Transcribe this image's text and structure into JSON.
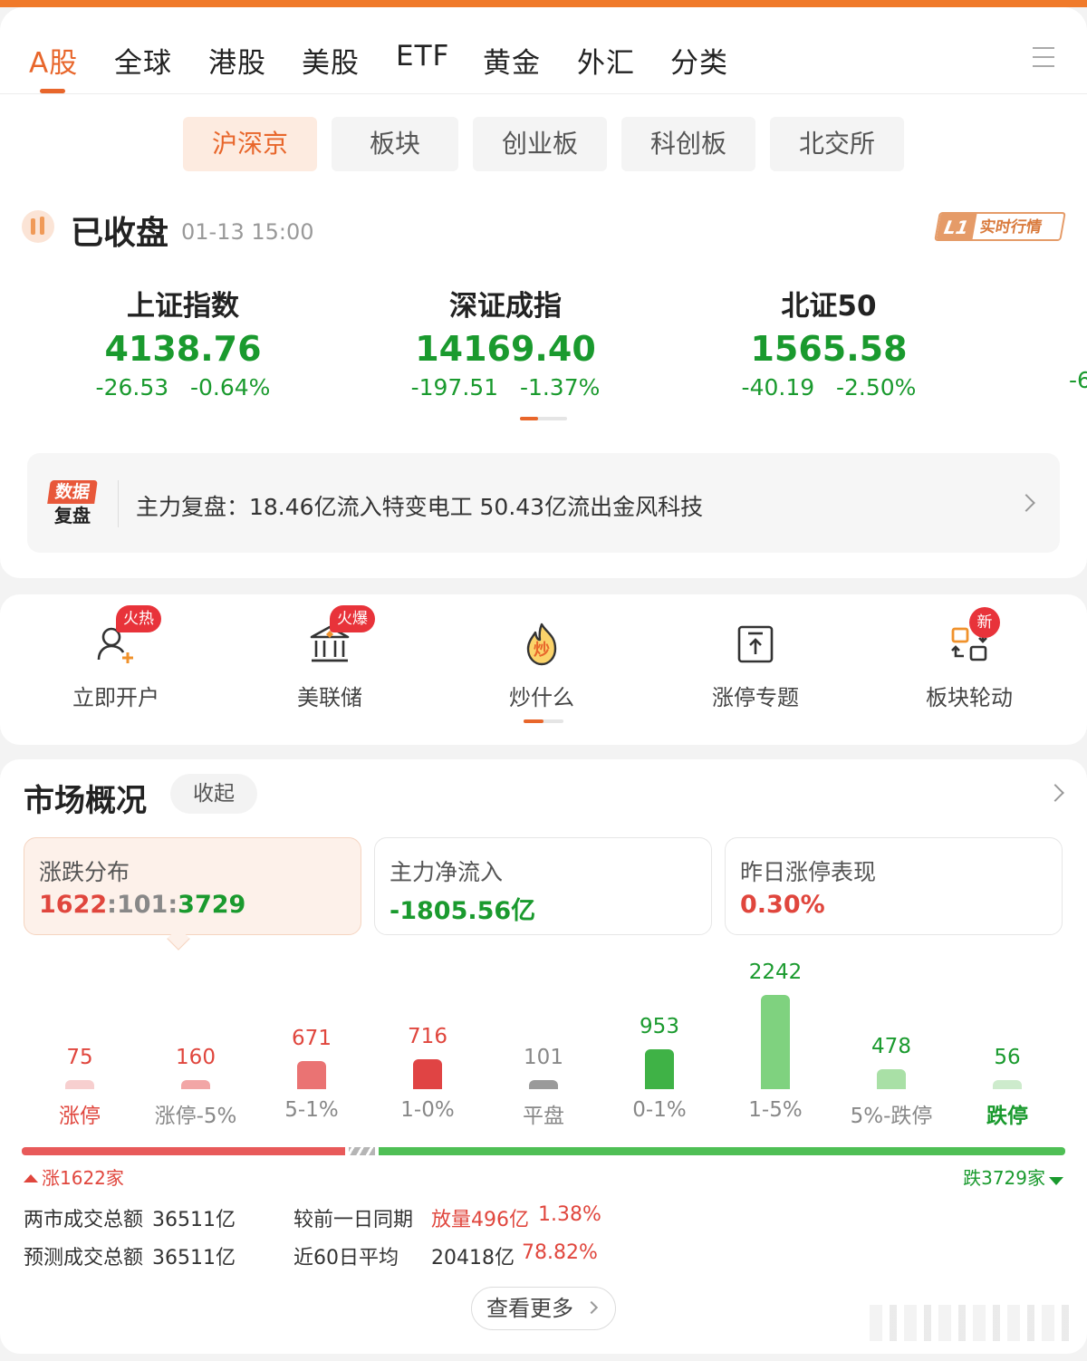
{
  "top_tabs": [
    "A股",
    "全球",
    "港股",
    "美股",
    "ETF",
    "黄金",
    "外汇",
    "分类"
  ],
  "active_top_tab": "A股",
  "sub_tabs": [
    "沪深京",
    "板块",
    "创业板",
    "科创板",
    "北交所"
  ],
  "active_sub_tab": "沪深京",
  "status": {
    "title": "已收盘",
    "time": "01-13 15:00",
    "badge_level": "L1",
    "badge_label": "实时行情"
  },
  "indices": [
    {
      "name": "上证指数",
      "value": "4138.76",
      "change": "-26.53",
      "pct": "-0.64%"
    },
    {
      "name": "深证成指",
      "value": "14169.40",
      "change": "-197.51",
      "pct": "-1.37%"
    },
    {
      "name": "北证50",
      "value": "1565.58",
      "change": "-40.19",
      "pct": "-2.50%"
    }
  ],
  "index_cut_off_text": "-6",
  "review": {
    "badge_top": "数据",
    "badge_bottom": "复盘",
    "text": "主力复盘：18.46亿流入特变电工 50.43亿流出金风科技"
  },
  "quick_entries": [
    {
      "label": "立即开户",
      "badge": "火热",
      "icon": "user-add-icon"
    },
    {
      "label": "美联储",
      "badge": "火爆",
      "icon": "bank-icon"
    },
    {
      "label": "炒什么",
      "badge": "",
      "icon": "fire-icon",
      "icon_text": "炒"
    },
    {
      "label": "涨停专题",
      "badge": "",
      "icon": "limit-up-icon"
    },
    {
      "label": "板块轮动",
      "badge": "新",
      "icon": "rotate-icon"
    }
  ],
  "market": {
    "title": "市场概况",
    "collapse_label": "收起",
    "boxes": [
      {
        "title": "涨跌分布",
        "up": "1622",
        "sep1": ":",
        "flat": "101",
        "sep2": ":",
        "down": "3729"
      },
      {
        "title": "主力净流入",
        "value": "-1805.56亿"
      },
      {
        "title": "昨日涨停表现",
        "value": "0.30%"
      }
    ],
    "up_count_label": "涨1622家",
    "down_count_label": "跌3729家",
    "stats": {
      "total_label": "两市成交总额",
      "total_value": "36511亿",
      "compare_label": "较前一日同期",
      "compare_value": "放量496亿",
      "compare_pct": "1.38%",
      "forecast_label": "预测成交总额",
      "forecast_value": "36511亿",
      "avg_label": "近60日平均",
      "avg_value": "20418亿",
      "avg_pct": "78.82%"
    },
    "more_label": "查看更多"
  },
  "chart_data": {
    "type": "bar",
    "categories": [
      "涨停",
      "涨停-5%",
      "5-1%",
      "1-0%",
      "平盘",
      "0-1%",
      "1-5%",
      "5%-跌停",
      "跌停"
    ],
    "values": [
      75,
      160,
      671,
      716,
      101,
      953,
      2242,
      478,
      56
    ],
    "colors": [
      "#f7cfcf",
      "#f2a6a6",
      "#ea7373",
      "#e04444",
      "#9a9a9a",
      "#3fb246",
      "#7fd27f",
      "#a9e0a6",
      "#cdebcc"
    ],
    "value_colors": [
      "#e0463d",
      "#e0463d",
      "#e0463d",
      "#e0463d",
      "#888888",
      "#1a9a2e",
      "#1a9a2e",
      "#1a9a2e",
      "#1a9a2e"
    ],
    "ylim": [
      0,
      2242
    ]
  },
  "colors": {
    "accent": "#e8662b",
    "up": "#e0463d",
    "down": "#1a9a2e"
  }
}
